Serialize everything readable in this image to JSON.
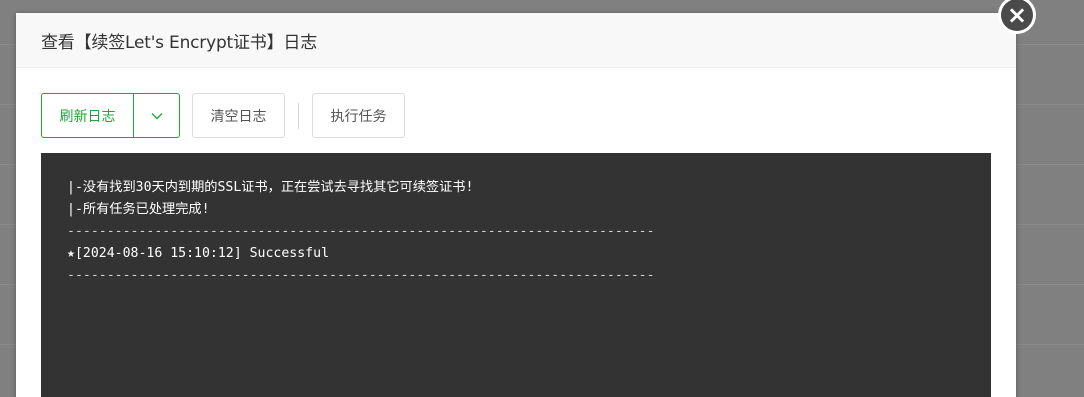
{
  "modal": {
    "title": "查看【续签Let's Encrypt证书】日志",
    "close_glyph": "×"
  },
  "toolbar": {
    "refresh_label": "刷新日志",
    "clear_label": "清空日志",
    "run_label": "执行任务"
  },
  "log": {
    "lines": [
      "|-没有找到30天内到期的SSL证书，正在尝试去寻找其它可续签证书!",
      "|-所有任务已处理完成!",
      "--------------------------------------------------------------------------",
      "★[2024-08-16 15:10:12] Successful",
      "--------------------------------------------------------------------------"
    ]
  },
  "colors": {
    "accent": "#20a53a",
    "log_background": "#333333",
    "log_text": "#ffffff"
  }
}
